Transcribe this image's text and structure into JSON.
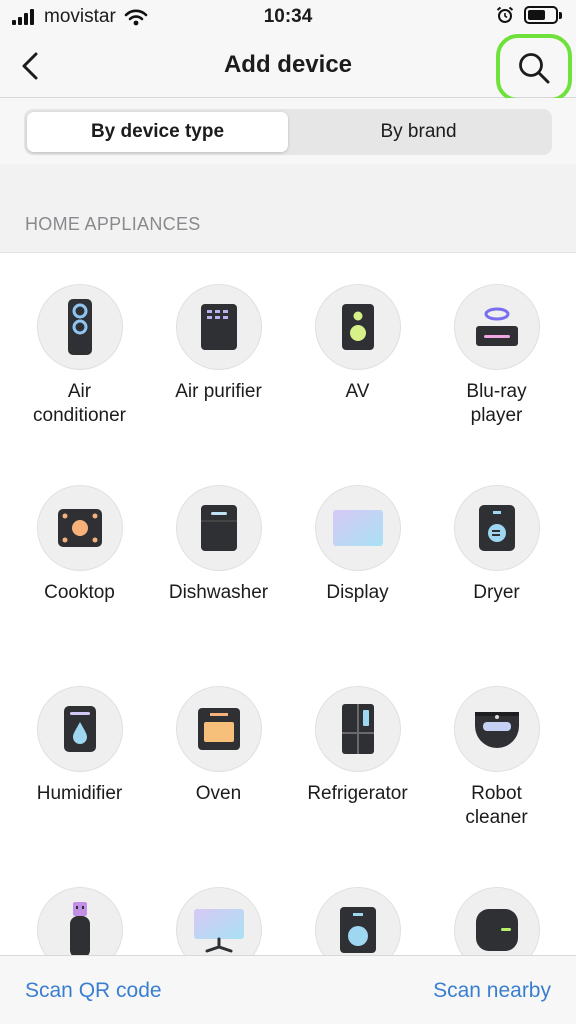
{
  "status_bar": {
    "carrier": "movistar",
    "time": "10:34",
    "battery_level": 0.65
  },
  "header": {
    "title": "Add device"
  },
  "segments": {
    "items": [
      "By device type",
      "By brand"
    ],
    "selected": "By device type"
  },
  "section": {
    "title": "HOME APPLIANCES"
  },
  "devices": [
    {
      "label": "Air\nconditioner",
      "icon": "air-conditioner-icon"
    },
    {
      "label": "Air purifier",
      "icon": "air-purifier-icon"
    },
    {
      "label": "AV",
      "icon": "av-icon"
    },
    {
      "label": "Blu-ray\nplayer",
      "icon": "bluray-player-icon"
    },
    {
      "label": "Cooktop",
      "icon": "cooktop-icon"
    },
    {
      "label": "Dishwasher",
      "icon": "dishwasher-icon"
    },
    {
      "label": "Display",
      "icon": "display-icon"
    },
    {
      "label": "Dryer",
      "icon": "dryer-icon"
    },
    {
      "label": "Humidifier",
      "icon": "humidifier-icon"
    },
    {
      "label": "Oven",
      "icon": "oven-icon"
    },
    {
      "label": "Refrigerator",
      "icon": "refrigerator-icon"
    },
    {
      "label": "Robot\ncleaner",
      "icon": "robot-cleaner-icon"
    },
    {
      "label": "",
      "icon": "usb-dongle-icon"
    },
    {
      "label": "",
      "icon": "tv-icon"
    },
    {
      "label": "",
      "icon": "washer-icon"
    },
    {
      "label": "",
      "icon": "smart-device-icon"
    }
  ],
  "bottom_bar": {
    "scan_qr": "Scan QR code",
    "scan_nearby": "Scan nearby"
  },
  "colors": {
    "accent": "#3a7fcf",
    "highlight": "#6ee23a"
  }
}
